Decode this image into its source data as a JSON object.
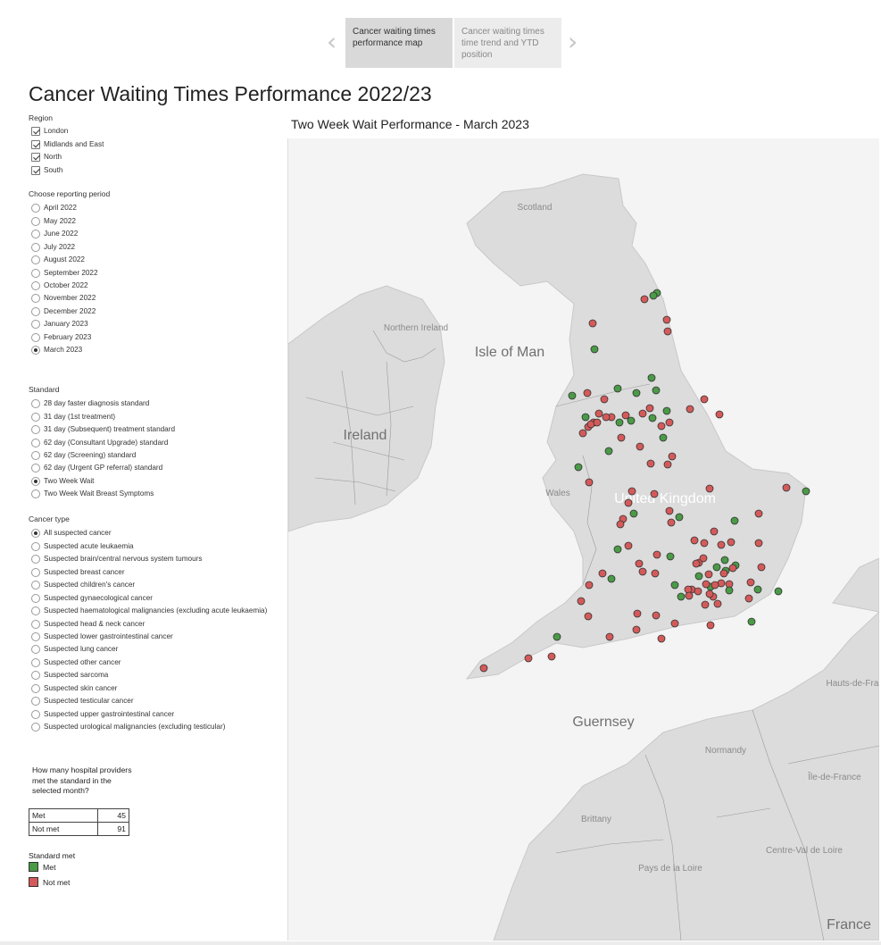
{
  "nav": {
    "tabs": [
      {
        "label": "Cancer waiting times performance map"
      },
      {
        "label": "Cancer waiting times time trend and YTD position"
      }
    ]
  },
  "title": "Cancer Waiting Times Performance 2022/23",
  "filters": {
    "region": {
      "title": "Region",
      "options": [
        {
          "label": "London",
          "checked": true
        },
        {
          "label": "Midlands and East",
          "checked": true
        },
        {
          "label": "North",
          "checked": true
        },
        {
          "label": "South",
          "checked": true
        }
      ]
    },
    "period": {
      "title": "Choose reporting period",
      "options": [
        "April 2022",
        "May 2022",
        "June 2022",
        "July 2022",
        "August 2022",
        "September 2022",
        "October 2022",
        "November 2022",
        "December 2022",
        "January 2023",
        "February 2023",
        "March 2023"
      ],
      "selected": "March 2023"
    },
    "standard": {
      "title": "Standard",
      "options": [
        "28 day faster diagnosis standard",
        "31 day (1st treatment)",
        "31 day (Subsequent) treatment standard",
        "62 day (Consultant Upgrade) standard",
        "62 day (Screening) standard",
        "62 day (Urgent GP referral) standard",
        "Two Week Wait",
        "Two Week Wait Breast Symptoms"
      ],
      "selected": "Two Week Wait"
    },
    "cancer_type": {
      "title": "Cancer type",
      "options": [
        "All suspected cancer",
        "Suspected acute leukaemia",
        "Suspected brain/central nervous system tumours",
        "Suspected breast cancer",
        "Suspected children's cancer",
        "Suspected gynaecological cancer",
        "Suspected haematological malignancies (excluding acute leukaemia)",
        "Suspected head & neck cancer",
        "Suspected lower gastrointestinal cancer",
        "Suspected lung cancer",
        "Suspected other cancer",
        "Suspected sarcoma",
        "Suspected skin cancer",
        "Suspected testicular cancer",
        "Suspected upper gastrointestinal cancer",
        "Suspected urological malignancies (excluding testicular)"
      ],
      "selected": "All suspected cancer"
    }
  },
  "summary": {
    "question": "How many hospital providers met the standard in the selected month?",
    "rows": [
      {
        "label": "Met",
        "value": "45"
      },
      {
        "label": "Not met",
        "value": "91"
      }
    ]
  },
  "legend": {
    "title": "Standard met",
    "items": [
      {
        "label": "Met",
        "color": "#4a9a46"
      },
      {
        "label": "Not met",
        "color": "#d45a5a"
      }
    ]
  },
  "map": {
    "title": "Two Week Wait Performance - March 2023",
    "place_labels": [
      "Scotland",
      "Northern Ireland",
      "Isle of Man",
      "Ireland",
      "Wales",
      "United Kingdom",
      "Guernsey",
      "Normandy",
      "Brittany",
      "Pays de la Loire",
      "Centre-Val de Loire",
      "Île-de-France",
      "Hauts-de-France",
      "France"
    ],
    "colors": {
      "met": "#4a9a46",
      "not_met": "#d45a5a",
      "land": "#dcdcdc",
      "sea": "#f4f4f4",
      "border": "#9a9a9a"
    }
  }
}
